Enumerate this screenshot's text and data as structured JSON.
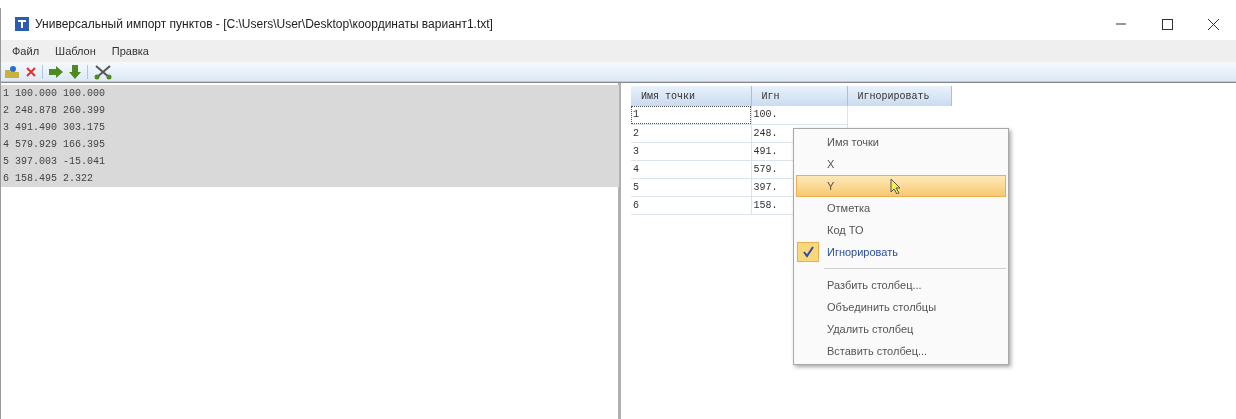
{
  "window": {
    "title": "Универсальный импорт пунктов - [C:\\Users\\User\\Desktop\\координаты вариант1.txt]"
  },
  "menu_bar": [
    "Файл",
    "Шаблон",
    "Правка"
  ],
  "source_text": {
    "lines": [
      "1 100.000 100.000",
      "2 248.878 260.399",
      "3 491.490 303.175",
      "4 579.929 166.395",
      "5 397.003 -15.041",
      "6 158.495 2.322"
    ]
  },
  "table": {
    "columns": [
      "Имя точки",
      "Игн",
      "Игнорировать"
    ],
    "rows": [
      {
        "cells": [
          "1",
          "100."
        ],
        "focused": true
      },
      {
        "cells": [
          "2",
          "248."
        ],
        "focused": false
      },
      {
        "cells": [
          "3",
          "491."
        ],
        "focused": false
      },
      {
        "cells": [
          "4",
          "579."
        ],
        "focused": false
      },
      {
        "cells": [
          "5",
          "397."
        ],
        "focused": false
      },
      {
        "cells": [
          "6",
          "158."
        ],
        "focused": false
      }
    ]
  },
  "context_menu": [
    {
      "kind": "item",
      "label": "Имя точки",
      "selected": false,
      "checked": false
    },
    {
      "kind": "item",
      "label": "X",
      "selected": false,
      "checked": false
    },
    {
      "kind": "item",
      "label": "Y",
      "selected": true,
      "checked": false
    },
    {
      "kind": "item",
      "label": "Отметка",
      "selected": false,
      "checked": false
    },
    {
      "kind": "item",
      "label": "Код ТО",
      "selected": false,
      "checked": false
    },
    {
      "kind": "item",
      "label": "Игнорировать",
      "selected": false,
      "checked": true
    },
    {
      "kind": "separator"
    },
    {
      "kind": "item",
      "label": "Разбить столбец...",
      "selected": false,
      "checked": false
    },
    {
      "kind": "item",
      "label": "Объединить столбцы",
      "selected": false,
      "checked": false
    },
    {
      "kind": "item",
      "label": "Удалить столбец",
      "selected": false,
      "checked": false
    },
    {
      "kind": "item",
      "label": "Вставить столбец...",
      "selected": false,
      "checked": false
    }
  ]
}
